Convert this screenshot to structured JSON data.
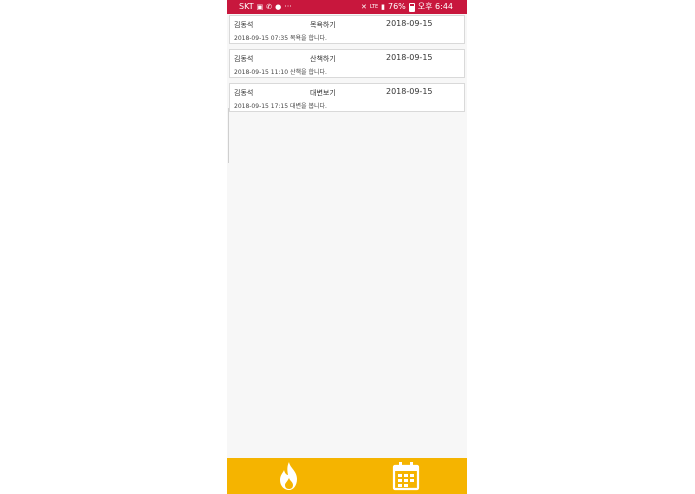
{
  "status_bar": {
    "carrier": "SKT",
    "dots": "···",
    "network": "LTE",
    "battery": "76%",
    "time": "오후 6:44"
  },
  "records": [
    {
      "name": "김동석",
      "activity": "목욕하기",
      "date": "2018-09-15",
      "description": "2018-09-15 07:35 목욕을 합니다."
    },
    {
      "name": "김동석",
      "activity": "산책하기",
      "date": "2018-09-15",
      "description": "2018-09-15 11:10 산책을 합니다."
    },
    {
      "name": "김동석",
      "activity": "대변보기",
      "date": "2018-09-15",
      "description": "2018-09-15 17:15 대변을 봅니다."
    }
  ],
  "tabs": [
    {
      "icon": "fire-icon"
    },
    {
      "icon": "calendar-icon"
    }
  ],
  "colors": {
    "status_bar": "#c8173d",
    "tab_bar": "#f5b400",
    "background": "#f7f7f7"
  }
}
